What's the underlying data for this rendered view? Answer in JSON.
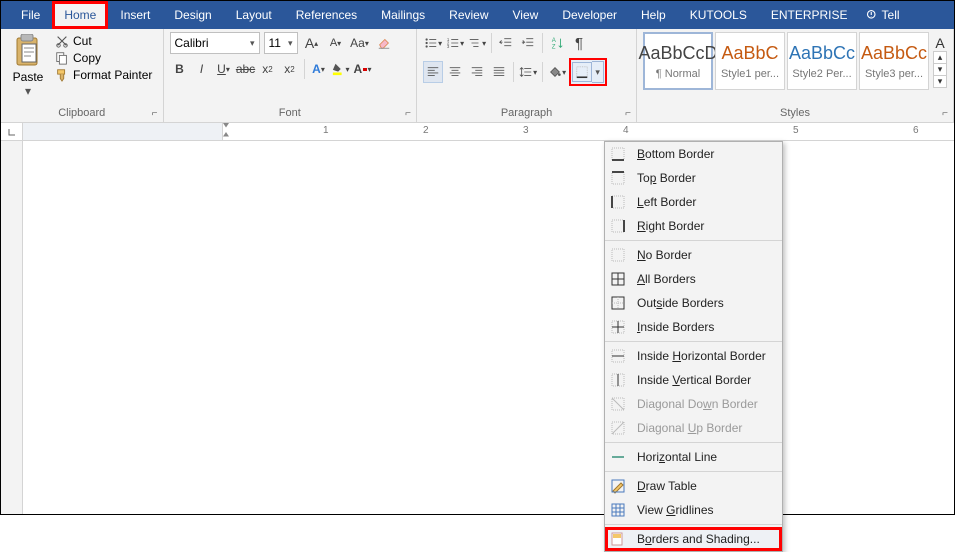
{
  "tabs": [
    "File",
    "Home",
    "Insert",
    "Design",
    "Layout",
    "References",
    "Mailings",
    "Review",
    "View",
    "Developer",
    "Help",
    "KUTOOLS",
    "ENTERPRISE"
  ],
  "activeTab": "Home",
  "tell": "Tell",
  "clipboard": {
    "label": "Clipboard",
    "paste": "Paste",
    "cut": "Cut",
    "copy": "Copy",
    "formatPainter": "Format Painter"
  },
  "font": {
    "label": "Font",
    "name": "Calibri",
    "size": "11"
  },
  "paragraph": {
    "label": "Paragraph"
  },
  "stylesGroup": {
    "label": "Styles",
    "items": [
      {
        "preview": "AaBbCcD",
        "name": "¶ Normal",
        "selected": true,
        "orange": false
      },
      {
        "preview": "AaBbC",
        "name": "Style1 per...",
        "selected": false,
        "orange": true
      },
      {
        "preview": "AaBbCc",
        "name": "Style2 Per...",
        "selected": false,
        "orange": false
      },
      {
        "preview": "AaBbCc",
        "name": "Style3 per...",
        "selected": false,
        "orange": true
      }
    ],
    "more": "A"
  },
  "ruler": {
    "nums": [
      "1",
      "2",
      "3",
      "4",
      "5",
      "6"
    ]
  },
  "bordersMenu": {
    "items": [
      {
        "key": "bottom",
        "label": "Bottom Border",
        "u": "B"
      },
      {
        "key": "top",
        "label": "Top Border",
        "u": "p"
      },
      {
        "key": "left",
        "label": "Left Border",
        "u": "L"
      },
      {
        "key": "right",
        "label": "Right Border",
        "u": "R"
      },
      {
        "sep": true
      },
      {
        "key": "none",
        "label": "No Border",
        "u": "N"
      },
      {
        "key": "all",
        "label": "All Borders",
        "u": "A"
      },
      {
        "key": "outside",
        "label": "Outside Borders",
        "u": "S"
      },
      {
        "key": "inside",
        "label": "Inside Borders",
        "u": "I"
      },
      {
        "sep": true
      },
      {
        "key": "insideH",
        "label": "Inside Horizontal Border",
        "u": "H"
      },
      {
        "key": "insideV",
        "label": "Inside Vertical Border",
        "u": "V"
      },
      {
        "key": "diagDown",
        "label": "Diagonal Down Border",
        "u": "W",
        "disabled": true
      },
      {
        "key": "diagUp",
        "label": "Diagonal Up Border",
        "u": "U",
        "disabled": true
      },
      {
        "sep": true
      },
      {
        "key": "hline",
        "label": "Horizontal Line",
        "u": "Z"
      },
      {
        "sep": true
      },
      {
        "key": "draw",
        "label": "Draw Table",
        "u": "D"
      },
      {
        "key": "grid",
        "label": "View Gridlines",
        "u": "G"
      },
      {
        "sep": true
      },
      {
        "key": "dialog",
        "label": "Borders and Shading...",
        "u": "O",
        "highlight": true
      }
    ]
  }
}
